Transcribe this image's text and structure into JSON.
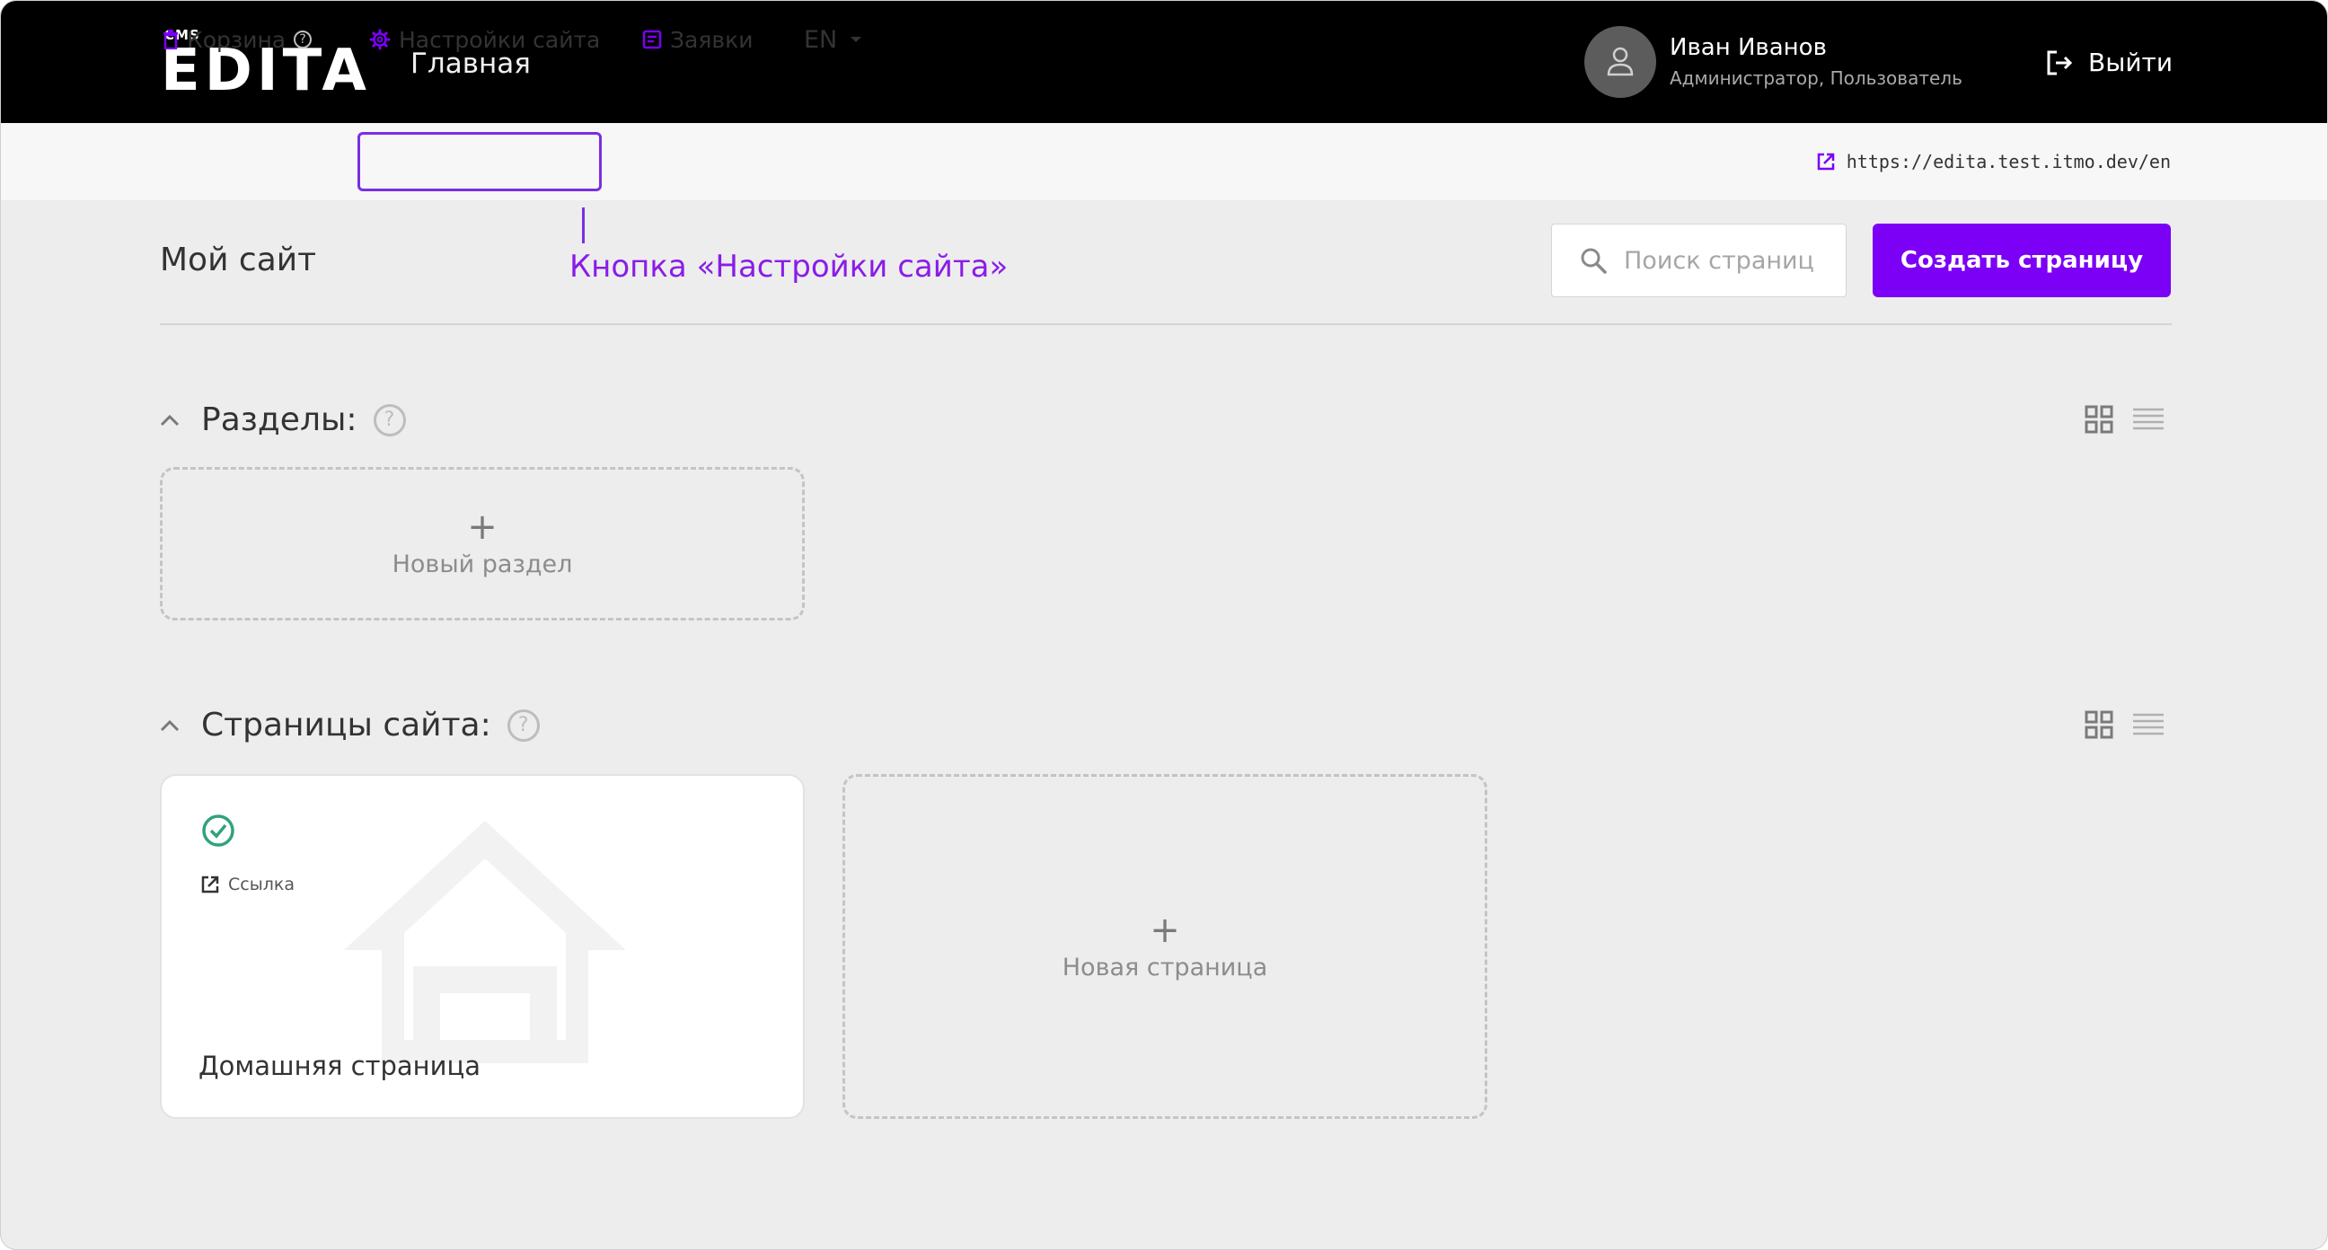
{
  "header": {
    "logo_small": "CMS",
    "logo": "EDITA",
    "nav_main": "Главная",
    "user_name": "Иван Иванов",
    "user_role": "Администратор, Пользователь",
    "logout_label": "Выйти"
  },
  "subnav": {
    "trash_label": "Корзина",
    "help_symbol": "?",
    "settings_label": "Настройки сайта",
    "requests_label": "Заявки",
    "language": "EN",
    "site_url": "https://edita.test.itmo.dev/en"
  },
  "annotation": {
    "callout_text": "Кнопка «Настройки сайта»",
    "highlight_color": "#7b2ee3"
  },
  "main": {
    "title": "Мой сайт",
    "search_placeholder": "Поиск страниц",
    "create_button": "Создать страницу",
    "accent_color": "#7b00f5"
  },
  "sections": {
    "title": "Разделы:",
    "help_symbol": "?",
    "new_plus": "+",
    "new_label": "Новый раздел"
  },
  "pages": {
    "title": "Страницы сайта:",
    "help_symbol": "?",
    "items": [
      {
        "link_label": "Ссылка",
        "name": "Домашняя страница",
        "status": "published-check-icon",
        "status_color": "#2fa37a"
      }
    ],
    "new_plus": "+",
    "new_label": "Новая страница"
  }
}
